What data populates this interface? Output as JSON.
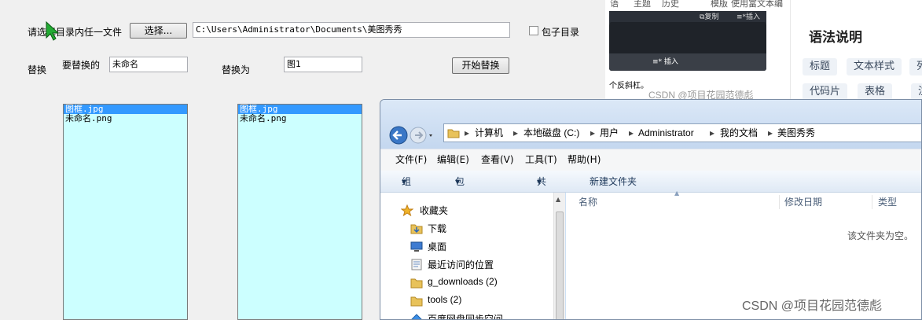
{
  "tool": {
    "select_label": "请选择目录内任一文件",
    "select_button": "选择...",
    "path_value": "C:\\Users\\Administrator\\Documents\\美图秀秀",
    "subdir_label": "包子目录",
    "replace_label": "替换",
    "to_replace_label": "要替换的",
    "to_replace_value": "未命名",
    "replace_with_label": "替换为",
    "replace_with_value": "图1",
    "start_button": "开始替换",
    "list_left": [
      "图框.jpg",
      "未命名.png"
    ],
    "list_right": [
      "图框.jpg",
      "未命名.png"
    ]
  },
  "editor": {
    "tabs": [
      "语",
      "主题",
      "历史",
      "模版",
      "使用富文本编辑器"
    ],
    "copy_label": "复制",
    "insert_label": "插入",
    "insert_bar_label": "插入",
    "note_text": "个反斜杠。",
    "watermark": "CSDN @项目花园范德彪",
    "syntax_title": "语法说明",
    "tags": [
      "标题",
      "文本样式",
      "列",
      "代码片",
      "表格",
      "注"
    ]
  },
  "explorer": {
    "breadcrumb": [
      "计算机",
      "本地磁盘 (C:)",
      "用户",
      "Administrator",
      "我的文档",
      "美图秀秀"
    ],
    "menu": [
      "文件(F)",
      "编辑(E)",
      "查看(V)",
      "工具(T)",
      "帮助(H)"
    ],
    "commands": [
      "组织",
      "包含到库中",
      "共享",
      "新建文件夹"
    ],
    "nav_items": [
      {
        "label": "收藏夹",
        "icon": "star-icon"
      },
      {
        "label": "下载",
        "icon": "download-folder-icon"
      },
      {
        "label": "桌面",
        "icon": "desktop-icon"
      },
      {
        "label": "最近访问的位置",
        "icon": "recent-places-icon"
      },
      {
        "label": "g_downloads (2)",
        "icon": "folder-icon"
      },
      {
        "label": "tools (2)",
        "icon": "folder-icon"
      },
      {
        "label": "百度网盘同步空间",
        "icon": "baidu-sync-icon"
      }
    ],
    "columns": [
      "名称",
      "修改日期",
      "类型"
    ],
    "empty_message": "该文件夹为空。"
  },
  "watermark": "CSDN @项目花园范德彪",
  "colors": {
    "list_bg": "#ccffff",
    "selection": "#3399ff",
    "explorer_frame": "#cde0f4",
    "editor_dark": "#1f2329"
  }
}
